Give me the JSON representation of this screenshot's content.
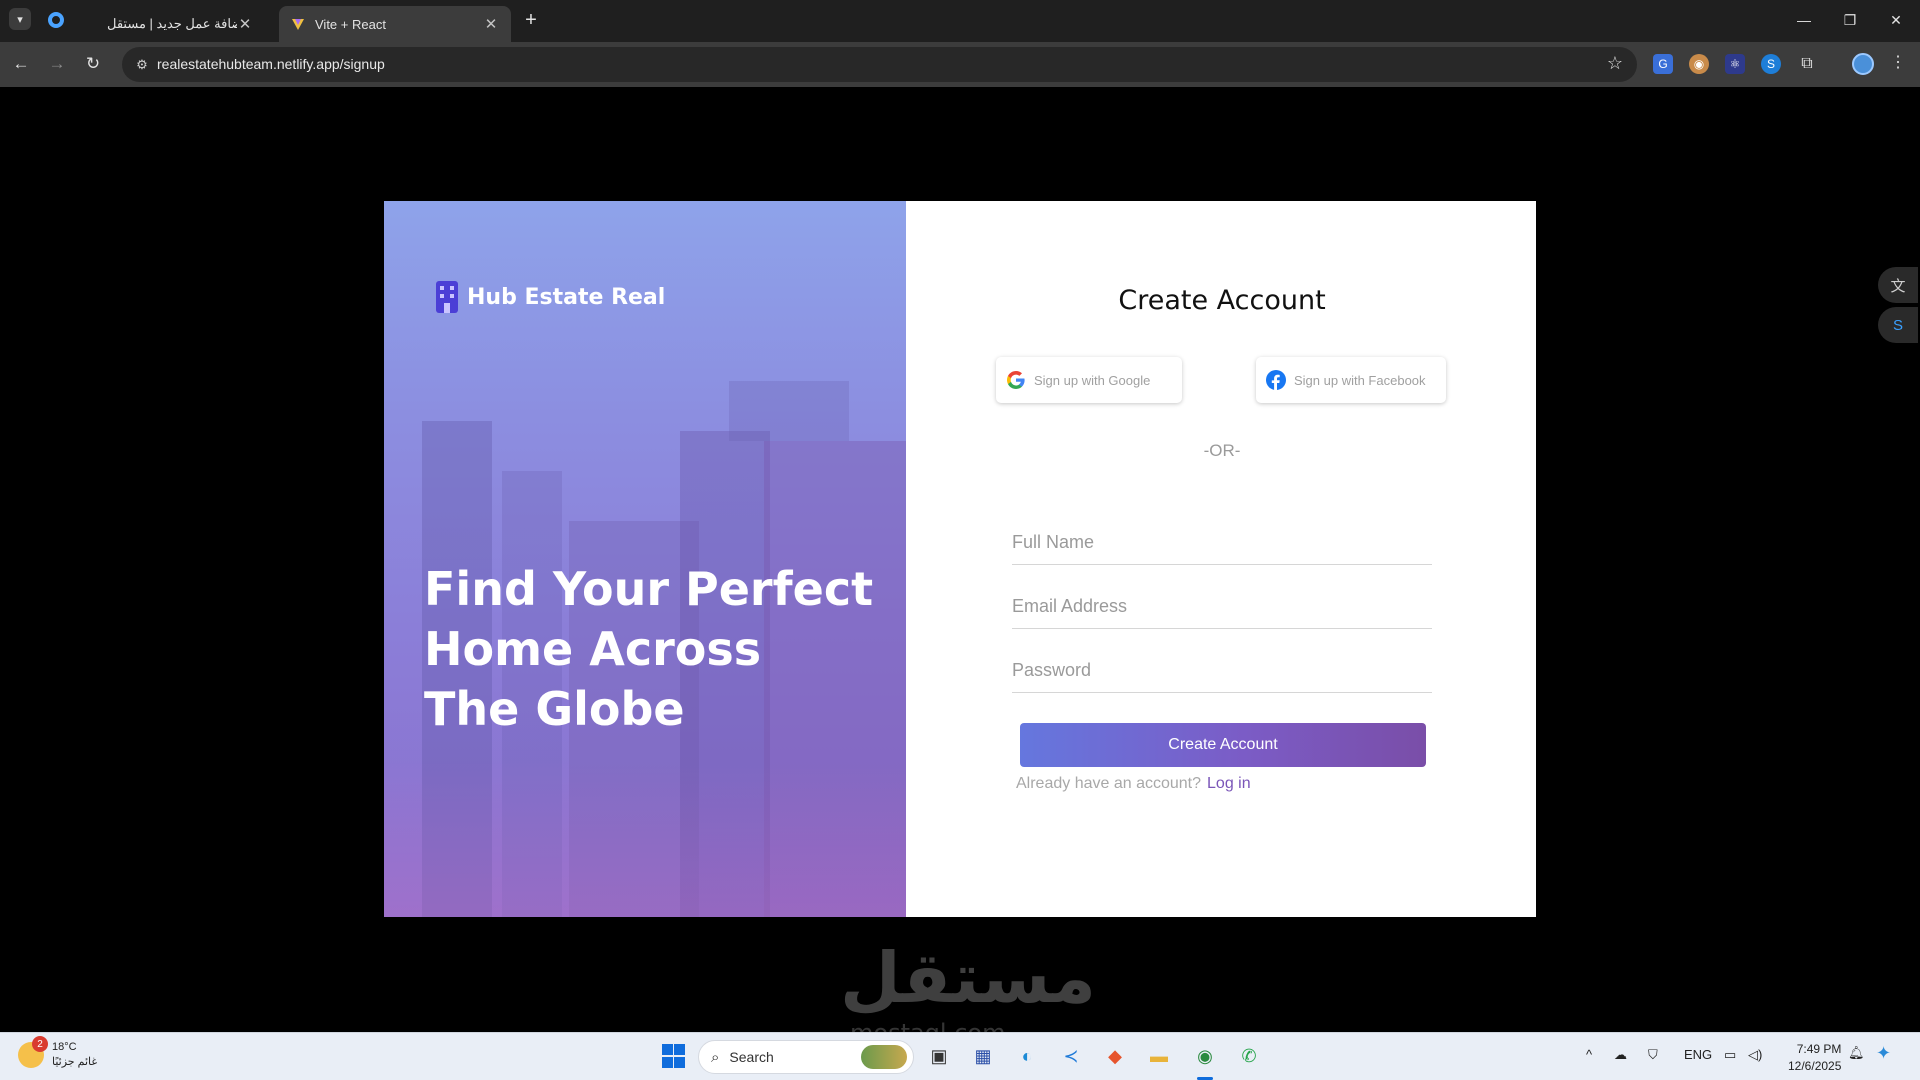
{
  "browser": {
    "tabs": [
      {
        "title": "إضافة عمل جديد | مستقل",
        "active": false
      },
      {
        "title": "Vite + React",
        "active": true
      }
    ],
    "url": "realestatehubteam.netlify.app/signup",
    "window_controls": {
      "minimize": "—",
      "restore": "❐",
      "close": "✕"
    }
  },
  "hero": {
    "brand_name": "Hub Estate Real",
    "headline_lines": [
      "Find Your Perfect",
      "Home Across",
      "The Globe"
    ]
  },
  "form": {
    "title": "Create Account",
    "google_label": "Sign up with Google",
    "facebook_label": "Sign up with Facebook",
    "or_text": "-OR-",
    "full_name_placeholder": "Full Name",
    "email_placeholder": "Email Address",
    "password_placeholder": "Password",
    "submit_label": "Create Account",
    "login_prompt": "Already have an account?",
    "login_link": "Log in"
  },
  "colors": {
    "accent_purple": "#7b5cc6",
    "button_gradient_start": "#6577de",
    "button_gradient_end": "#7a4ea8",
    "google_blue": "#4285f4",
    "facebook_blue": "#1877f2"
  },
  "watermark": {
    "arabic": "مستقل",
    "latin": "mostaql.com"
  },
  "taskbar": {
    "weather_temp": "18°C",
    "weather_desc": "غائم جزئيًا",
    "weather_badge": "2",
    "search_label": "Search",
    "language": "ENG",
    "time": "7:49 PM",
    "date": "12/6/2025"
  }
}
